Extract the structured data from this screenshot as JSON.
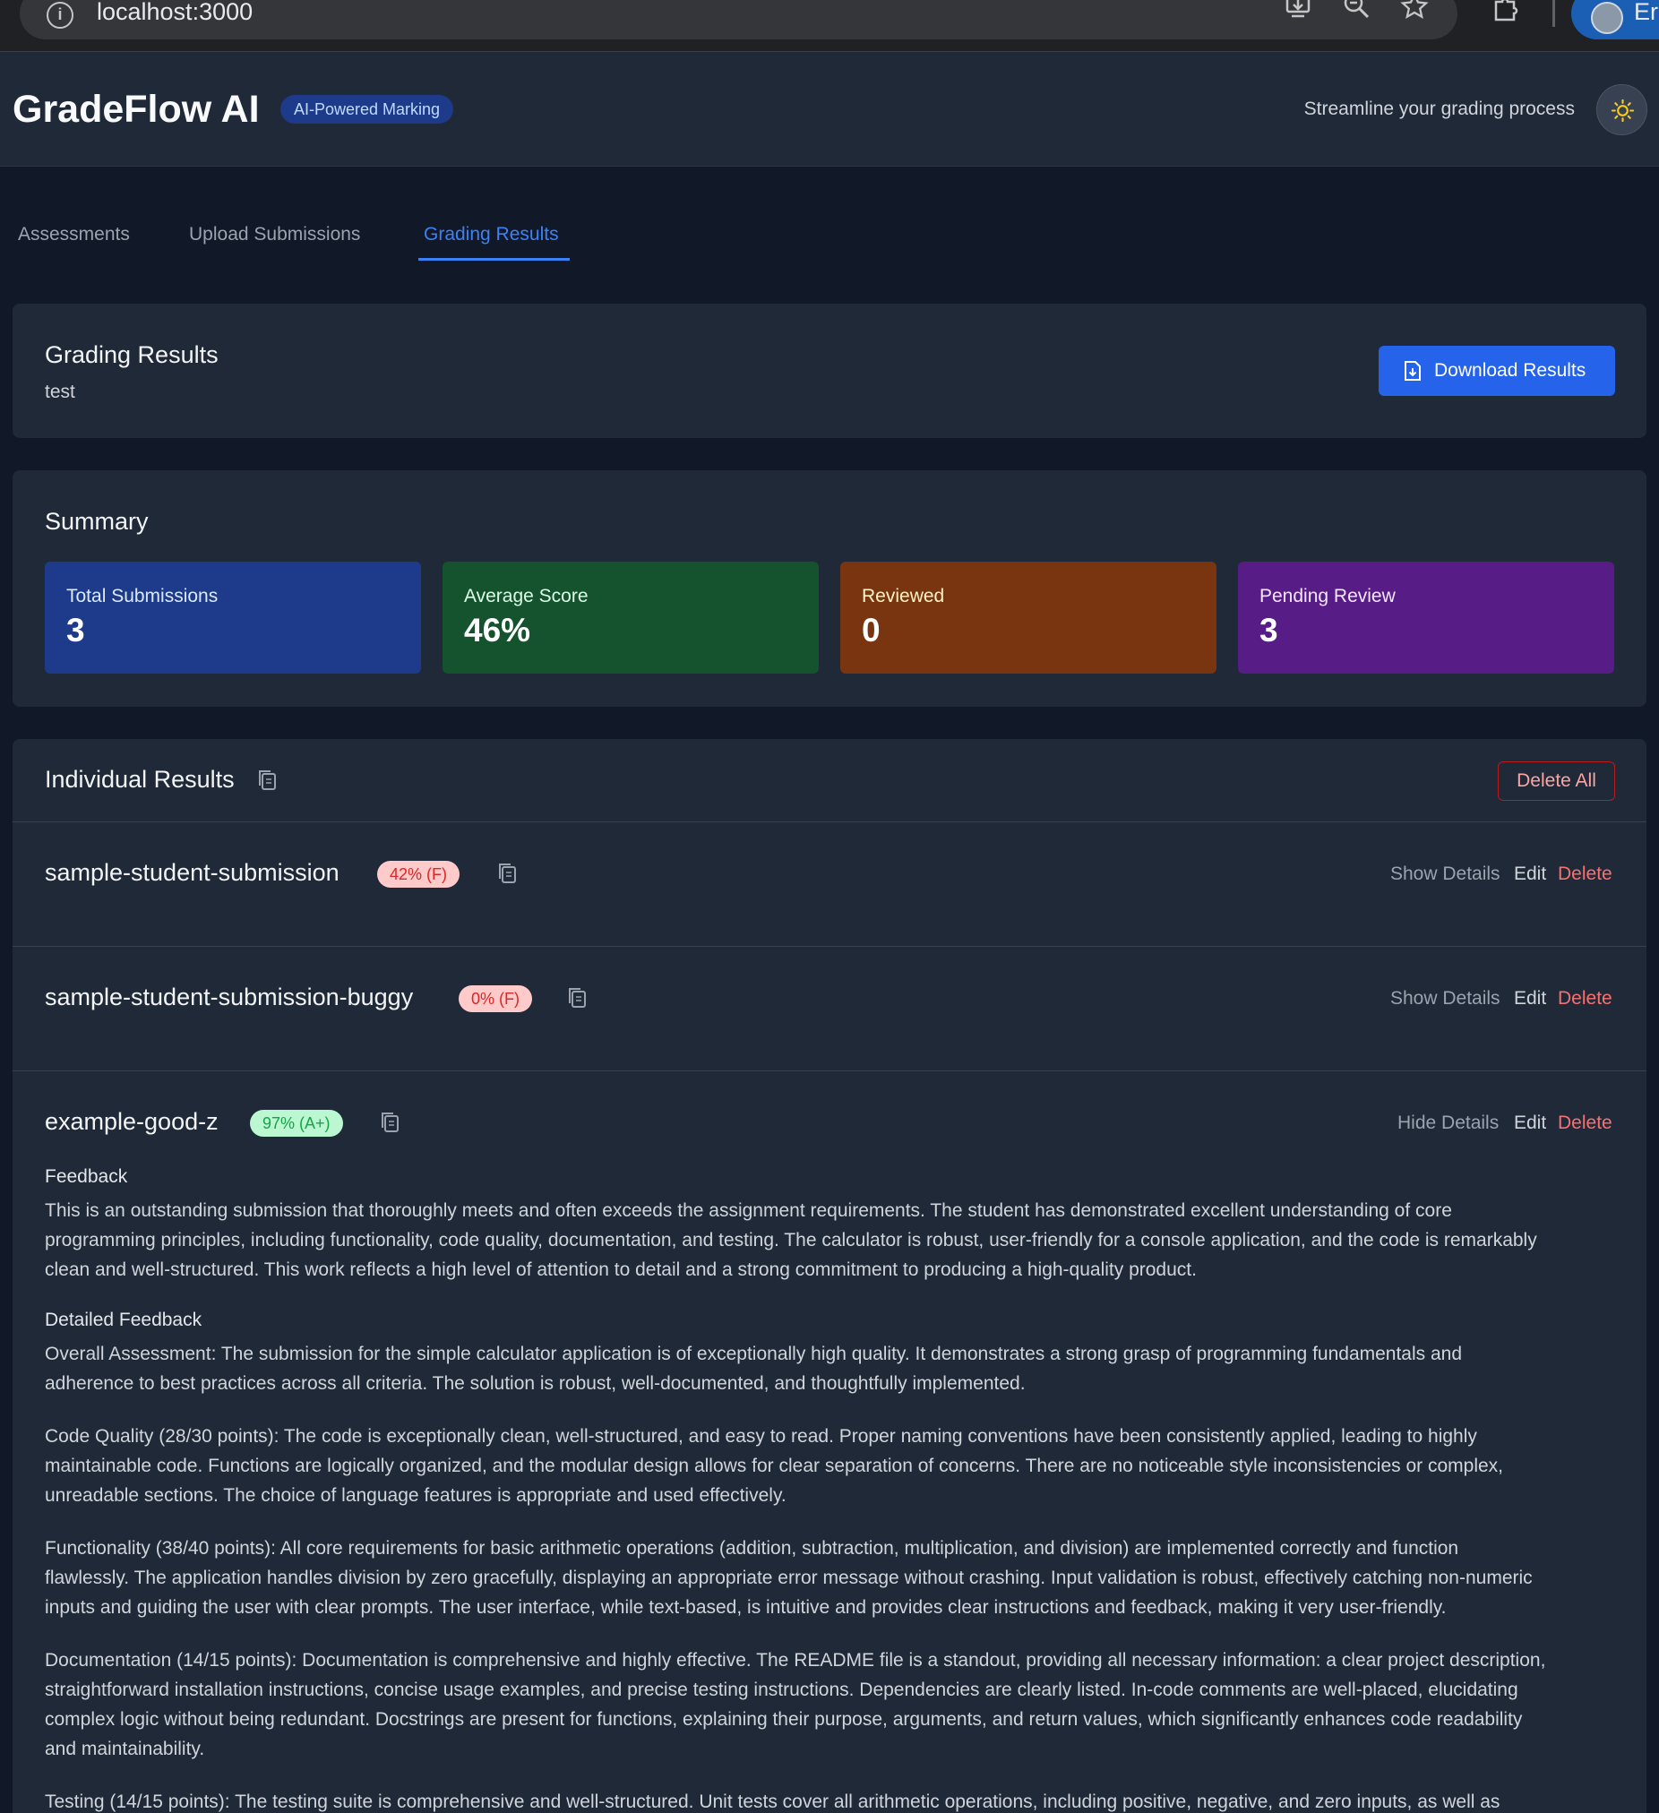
{
  "browser": {
    "url": "localhost:3000",
    "profile_text": "Er",
    "info_glyph": "i"
  },
  "header": {
    "title": "GradeFlow AI",
    "badge": "AI-Powered Marking",
    "tagline": "Streamline your grading process"
  },
  "tabs": [
    {
      "label": "Assessments",
      "active": false
    },
    {
      "label": "Upload Submissions",
      "active": false
    },
    {
      "label": "Grading Results",
      "active": true
    }
  ],
  "results_header": {
    "title": "Grading Results",
    "assessment_name": "test",
    "download_label": "Download Results"
  },
  "summary": {
    "title": "Summary",
    "stats": [
      {
        "label": "Total Submissions",
        "value": "3",
        "color": "#1e3a8a"
      },
      {
        "label": "Average Score",
        "value": "46%",
        "color": "#14532d"
      },
      {
        "label": "Reviewed",
        "value": "0",
        "color": "#78350f"
      },
      {
        "label": "Pending Review",
        "value": "3",
        "color": "#581c87"
      }
    ]
  },
  "individual": {
    "title": "Individual Results",
    "delete_all_label": "Delete All",
    "rows": [
      {
        "name": "sample-student-submission",
        "score": "42% (F)",
        "details_label": "Show Details",
        "edit_label": "Edit",
        "delete_label": "Delete"
      },
      {
        "name": "sample-student-submission-buggy",
        "score": "0% (F)",
        "details_label": "Show Details",
        "edit_label": "Edit",
        "delete_label": "Delete"
      },
      {
        "name": "example-good-z",
        "score": "97% (A+)",
        "details_label": "Hide Details",
        "edit_label": "Edit",
        "delete_label": "Delete"
      }
    ],
    "expanded": {
      "feedback_label": "Feedback",
      "feedback_lines": [
        "This is an outstanding submission that thoroughly meets and often exceeds the assignment requirements. The student has demonstrated excellent understanding of core",
        "programming principles, including functionality, code quality, documentation, and testing. The calculator is robust, user-friendly for a console application, and the code is remarkably",
        "clean and well-structured. This work reflects a high level of attention to detail and a strong commitment to producing a high-quality product."
      ],
      "detailed_label": "Detailed Feedback",
      "overall_lines": [
        "Overall Assessment: The submission for the simple calculator application is of exceptionally high quality. It demonstrates a strong grasp of programming fundamentals and",
        "adherence to best practices across all criteria. The solution is robust, well-documented, and thoughtfully implemented."
      ],
      "code_quality_lines": [
        "Code Quality (28/30 points): The code is exceptionally clean, well-structured, and easy to read. Proper naming conventions have been consistently applied, leading to highly",
        "maintainable code. Functions are logically organized, and the modular design allows for clear separation of concerns. There are no noticeable style inconsistencies or complex,",
        "unreadable sections. The choice of language features is appropriate and used effectively."
      ],
      "functionality_lines": [
        "Functionality (38/40 points): All core requirements for basic arithmetic operations (addition, subtraction, multiplication, and division) are implemented correctly and function",
        "flawlessly. The application handles division by zero gracefully, displaying an appropriate error message without crashing. Input validation is robust, effectively catching non-numeric",
        "inputs and guiding the user with clear prompts. The user interface, while text-based, is intuitive and provides clear instructions and feedback, making it very user-friendly."
      ],
      "documentation_lines": [
        "Documentation (14/15 points): Documentation is comprehensive and highly effective. The README file is a standout, providing all necessary information: a clear project description,",
        "straightforward installation instructions, concise usage examples, and precise testing instructions. Dependencies are clearly listed. In-code comments are well-placed, elucidating",
        "complex logic without being redundant. Docstrings are present for functions, explaining their purpose, arguments, and return values, which significantly enhances code readability",
        "and maintainability."
      ],
      "testing_lines": [
        "Testing (14/15 points): The testing suite is comprehensive and well-structured. Unit tests cover all arithmetic operations, including positive, negative, and zero inputs, as well as"
      ]
    }
  },
  "colors": {
    "accent": "#3b82f6",
    "fail_pill": "#fecaca",
    "pass_pill": "#bbf7d0",
    "danger": "#f87171"
  }
}
